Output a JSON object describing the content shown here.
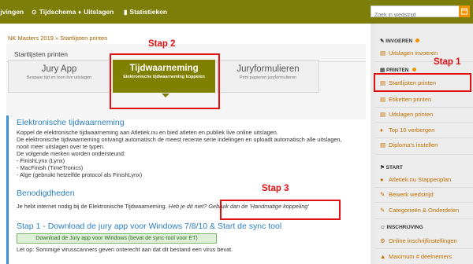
{
  "topnav": {
    "items": [
      {
        "icon": "",
        "label": "ijvingen"
      },
      {
        "icon": "⊙",
        "label": "Tijdschema"
      },
      {
        "icon": "♦",
        "label": "Uitslagen"
      },
      {
        "icon": "▮",
        "label": "Statistieken"
      }
    ],
    "search_placeholder": "Zoek in wedstrijd"
  },
  "breadcrumb": "NK Masters 2019 » Startlijsten printen",
  "card": {
    "title": "Startlijsten printen",
    "tabs": [
      {
        "title": "Jury App",
        "subtitle": "Bespaar tijd en toon live uitslagen"
      },
      {
        "title": "Tijdwaarneming",
        "subtitle": "Elektronische tijdwaarneming koppelen"
      },
      {
        "title": "Juryformulieren",
        "subtitle": "Print papieren juryformulieren"
      }
    ]
  },
  "annotations": {
    "stap1": "Stap 1",
    "stap2": "Stap 2",
    "stap3": "Stap 3"
  },
  "content": {
    "heading1": "Elektronische tijdwaarneming",
    "para1": [
      "Koppel de elektronische tijdwaarneming aan Atletiek.nu en bied atleten en publiek live online uitslagen.",
      "De elektronische tijdwaarneming ontvangt automatisch de meest recente serie indelingen en uploadt automatisch alle uitslagen,",
      "nooit meer uitslagen over te typen.",
      "De volgende merken worden ondersteund:",
      "- FinishLynx (Lynx)",
      "- MacFinish (TimeTronics)",
      "- Alge (gebruikt hetzelfde protocol als FinishLynx)"
    ],
    "heading2": "Benodigdheden",
    "para2_a": "Je hebt internet nodig bij de Elektronische Tijdwaarneming. ",
    "para2_b": "Heb je dit niet? Gebruik dan de 'Handmatige koppeling'",
    "heading3": "Stap 1 - Download de jury app voor Windows 7/8/10 & Start de sync tool",
    "download_button": "Download de Jury app voor Windows (bevat de sync-tool voor ET)",
    "note": "Let op: Sommige virusscanners geven onterecht aan dat dit bestand een virus bevat."
  },
  "sidebar": {
    "sections": [
      {
        "heading": "INVOEREN",
        "dot": true,
        "items": [
          {
            "icon": "▤",
            "label": "Uitslagen invoeren"
          }
        ]
      },
      {
        "heading": "PRINTEN",
        "dot": true,
        "items": [
          {
            "icon": "▤",
            "label": "Startlijsten printen"
          },
          {
            "icon": "▤",
            "label": "Etiketten printen"
          },
          {
            "icon": "▤",
            "label": "Uitslagen printen"
          },
          {
            "icon": "♦",
            "label": "Top 10 verbergen"
          },
          {
            "icon": "▤",
            "label": "Diploma's instellen"
          }
        ]
      },
      {
        "heading": "START",
        "dot": false,
        "items": [
          {
            "icon": "●",
            "label": "Atletiek.nu Stappenplan"
          },
          {
            "icon": "✎",
            "label": "Bewerk wedstrijd"
          },
          {
            "icon": "✎",
            "label": "Categorieën & Onderdelen"
          }
        ]
      },
      {
        "heading": "INSCHRIJVING",
        "dot": false,
        "items": [
          {
            "icon": "⚙",
            "label": "Online inschrijfinstellingen"
          },
          {
            "icon": "▲",
            "label": "Maximum # deelnemers"
          }
        ]
      }
    ]
  },
  "colors": {
    "topbar": "#7d7d0a",
    "accent": "#f39200",
    "active_tab": "#808000",
    "annotation": "#e01010",
    "heading_blue": "#2a7fc2",
    "link_orange": "#c27000"
  }
}
